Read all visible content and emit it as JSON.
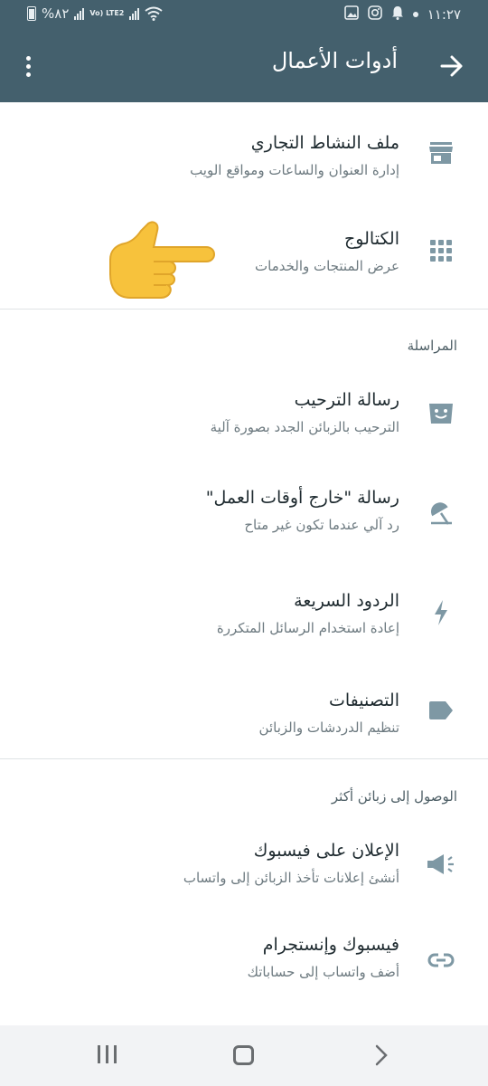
{
  "status_bar": {
    "battery": "%٨٢",
    "network": "Vo) LTE2",
    "time": "١١:٢٧"
  },
  "app_bar": {
    "title": "أدوات الأعمال",
    "back_icon": "arrow-back-icon",
    "menu_icon": "more-vert-icon"
  },
  "items_top": [
    {
      "title": "ملف النشاط التجاري",
      "subtitle": "إدارة العنوان والساعات ومواقع الويب",
      "icon": "store-icon"
    },
    {
      "title": "الكتالوج",
      "subtitle": "عرض المنتجات والخدمات",
      "icon": "grid-icon"
    }
  ],
  "messaging": {
    "header": "المراسلة",
    "items": [
      {
        "title": "رسالة الترحيب",
        "subtitle": "الترحيب بالزبائن الجدد بصورة آلية",
        "icon": "smiley-message-icon"
      },
      {
        "title": "رسالة \"خارج أوقات العمل\"",
        "subtitle": "رد آلي عندما تكون غير متاح",
        "icon": "umbrella-off-icon"
      },
      {
        "title": "الردود السريعة",
        "subtitle": "إعادة استخدام الرسائل المتكررة",
        "icon": "lightning-icon"
      },
      {
        "title": "التصنيفات",
        "subtitle": "تنظيم الدردشات والزبائن",
        "icon": "label-icon"
      }
    ]
  },
  "reach": {
    "header": "الوصول إلى زبائن أكثر",
    "items": [
      {
        "title": "الإعلان على فيسبوك",
        "subtitle": "أنشئ إعلانات تأخذ الزبائن إلى واتساب",
        "icon": "megaphone-icon"
      },
      {
        "title": "فيسبوك وإنستجرام",
        "subtitle": "أضف واتساب إلى حساباتك",
        "icon": "link-icon"
      }
    ]
  },
  "overlay": {
    "icon": "pointing-hand-emoji-icon"
  },
  "nav_bar": {
    "recent_icon": "recent-apps-icon",
    "home_icon": "home-icon",
    "back_icon": "nav-back-icon"
  },
  "colors": {
    "header_bg": "#44606d",
    "icon": "#7e98a4",
    "text": "#1f2b30",
    "subtext": "#6d7a80"
  }
}
